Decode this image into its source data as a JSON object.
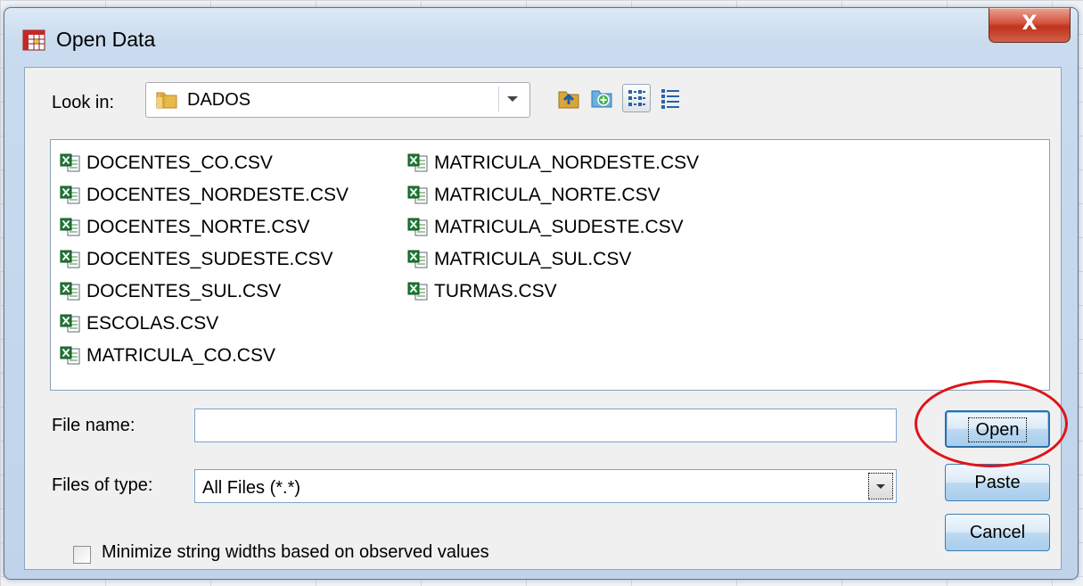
{
  "window": {
    "title": "Open Data",
    "close_glyph": "X"
  },
  "look_in": {
    "label": "Look in:",
    "folder": "DADOS"
  },
  "toolbar": {
    "icons": [
      "up-folder-icon",
      "new-folder-icon",
      "list-view-icon",
      "details-view-icon"
    ]
  },
  "files": {
    "column1": [
      "DOCENTES_CO.CSV",
      "DOCENTES_NORDESTE.CSV",
      "DOCENTES_NORTE.CSV",
      "DOCENTES_SUDESTE.CSV",
      "DOCENTES_SUL.CSV",
      "ESCOLAS.CSV",
      "MATRICULA_CO.CSV"
    ],
    "column2": [
      "MATRICULA_NORDESTE.CSV",
      "MATRICULA_NORTE.CSV",
      "MATRICULA_SUDESTE.CSV",
      "MATRICULA_SUL.CSV",
      "TURMAS.CSV"
    ]
  },
  "file_name": {
    "label": "File name:",
    "value": ""
  },
  "file_type": {
    "label": "Files of type:",
    "value": "All Files (*.*)"
  },
  "buttons": {
    "open": "Open",
    "paste": "Paste",
    "cancel": "Cancel"
  },
  "options": {
    "minimize_label": "Minimize string widths based on observed values",
    "minimize_checked": false
  },
  "colors": {
    "highlight_circle": "#e0131b",
    "button_border": "#3c7fb1"
  }
}
